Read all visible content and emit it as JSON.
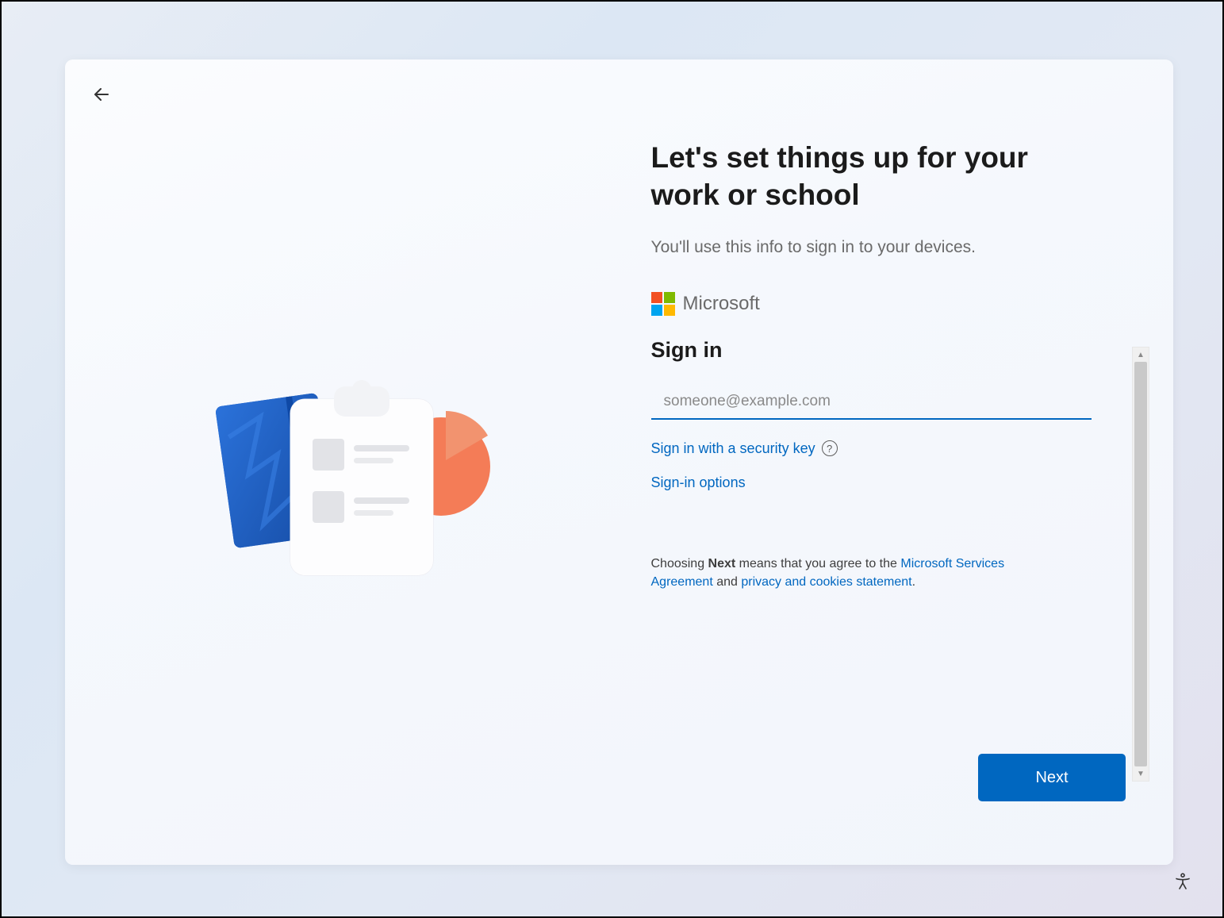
{
  "header": {
    "title": "Let's set things up for your work or school",
    "subtitle": "You'll use this info to sign in to your devices."
  },
  "brand": {
    "name": "Microsoft"
  },
  "signin": {
    "heading": "Sign in",
    "email_placeholder": "someone@example.com",
    "email_value": "",
    "security_key_link": "Sign in with a security key",
    "options_link": "Sign-in options",
    "help_glyph": "?"
  },
  "consent": {
    "prefix": "Choosing ",
    "bold_word": "Next",
    "middle": " means that you agree to the ",
    "link1": "Microsoft Services Agreement",
    "and": " and ",
    "link2": "privacy and cookies statement",
    "suffix": "."
  },
  "actions": {
    "next_label": "Next"
  },
  "scroll": {
    "up_glyph": "▲",
    "down_glyph": "▼"
  }
}
